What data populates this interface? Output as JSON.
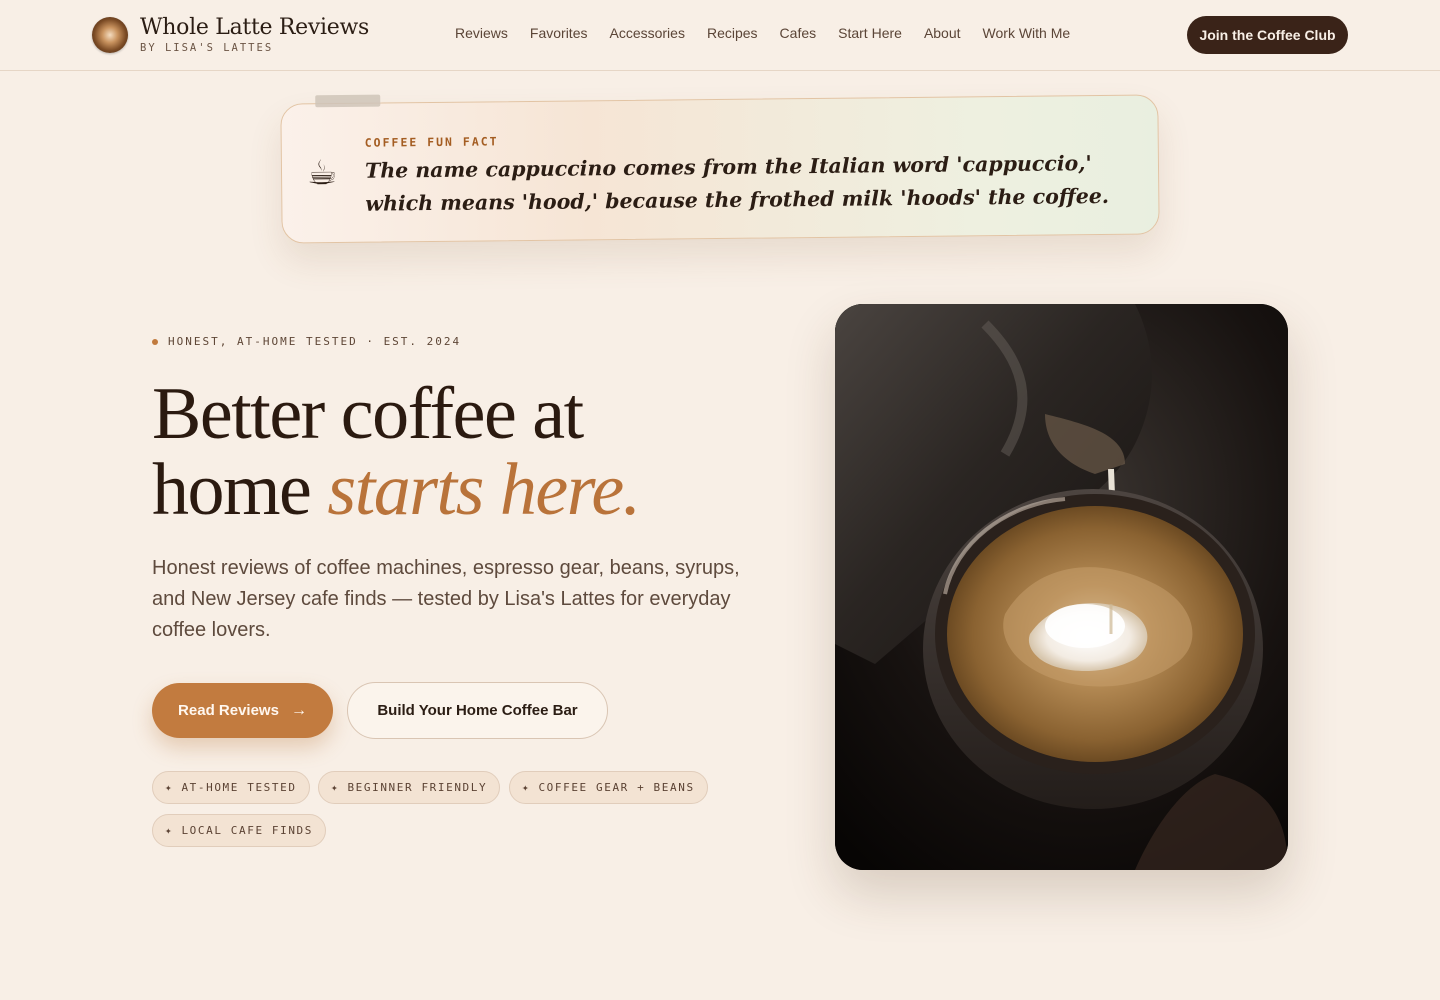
{
  "header": {
    "brand_title": "Whole Latte Reviews",
    "brand_subtitle": "BY LISA'S LATTES",
    "nav": [
      "Reviews",
      "Favorites",
      "Accessories",
      "Recipes",
      "Cafes",
      "Start Here",
      "About",
      "Work With Me"
    ],
    "cta_label": "Join the Coffee Club"
  },
  "fun_fact": {
    "icon": "coffee-cup-icon",
    "label": "COFFEE FUN FACT",
    "text": "The name cappuccino comes from the Italian word 'cappuccio,' which means 'hood,' because the frothed milk 'hoods' the coffee."
  },
  "hero": {
    "eyebrow": "HONEST, AT-HOME TESTED · EST. 2024",
    "headline_line1": "Better coffee at",
    "headline_line2_plain": "home",
    "headline_line2_accent": "starts here.",
    "lede": "Honest reviews of coffee machines, espresso gear, beans, syrups, and New Jersey cafe finds — tested by Lisa's Lattes for everyday coffee lovers.",
    "primary_cta": "Read Reviews",
    "primary_cta_icon": "arrow-right-icon",
    "secondary_cta": "Build Your Home Coffee Bar",
    "tags": [
      "✦ AT-HOME TESTED",
      "✦ BEGINNER FRIENDLY",
      "✦ COFFEE GEAR + BEANS",
      "✦ LOCAL CAFE FINDS"
    ],
    "image": "latte-art-pour-photo"
  },
  "colors": {
    "background": "#f8efe6",
    "accent": "#c27b3f",
    "dark": "#3a2318",
    "fact_label": "#a45d22"
  }
}
